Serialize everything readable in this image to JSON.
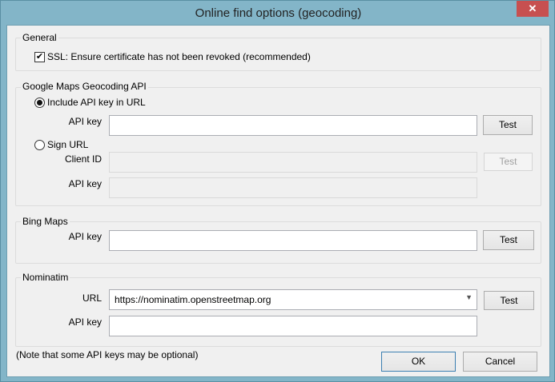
{
  "window": {
    "title": "Online find options (geocoding)",
    "close": "✕"
  },
  "general": {
    "title": "General",
    "ssl_label": "SSL: Ensure certificate has not been revoked (recommended)",
    "ssl_checked": true
  },
  "google": {
    "title": "Google Maps Geocoding API",
    "include_key_label": "Include API key in URL",
    "api_key_label": "API key",
    "api_key_value": "",
    "test": "Test",
    "sign_url_label": "Sign URL",
    "client_id_label": "Client ID",
    "client_id_value": "",
    "api_key2_label": "API key",
    "api_key2_value": "",
    "selected": "include"
  },
  "bing": {
    "title": "Bing Maps",
    "api_key_label": "API key",
    "api_key_value": "",
    "test": "Test"
  },
  "nominatim": {
    "title": "Nominatim",
    "url_label": "URL",
    "url_value": "https://nominatim.openstreetmap.org",
    "api_key_label": "API key",
    "api_key_value": "",
    "test": "Test"
  },
  "footer": {
    "note": "(Note that some API keys may be optional)",
    "ok": "OK",
    "cancel": "Cancel"
  }
}
